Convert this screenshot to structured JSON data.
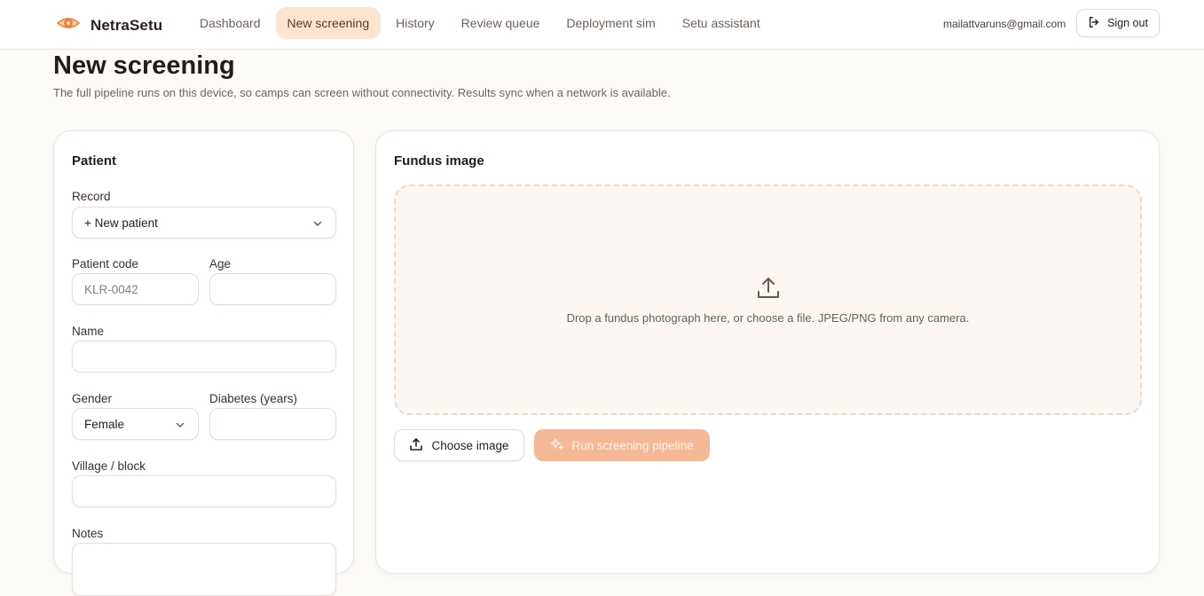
{
  "brand": {
    "name": "NetraSetu",
    "accent": "#f0803c"
  },
  "nav": [
    {
      "label": "Dashboard",
      "active": false
    },
    {
      "label": "New screening",
      "active": true
    },
    {
      "label": "History",
      "active": false
    },
    {
      "label": "Review queue",
      "active": false
    },
    {
      "label": "Deployment sim",
      "active": false
    },
    {
      "label": "Setu assistant",
      "active": false
    }
  ],
  "user": {
    "email": "mailattvaruns@gmail.com",
    "signout_label": "Sign out",
    "signout_icon": "logout-icon"
  },
  "page": {
    "title": "New screening",
    "subtitle": "The full pipeline runs on this device, so camps can screen without connectivity. Results sync when a network is available."
  },
  "patient": {
    "title": "Patient",
    "record_label": "Record",
    "record_value": "+ New patient",
    "code_label": "Patient code",
    "code_placeholder": "KLR-0042",
    "age_label": "Age",
    "name_label": "Name",
    "gender_label": "Gender",
    "gender_value": "Female",
    "diabetes_label": "Diabetes (years)",
    "village_label": "Village / block",
    "notes_label": "Notes"
  },
  "fundus": {
    "title": "Fundus image",
    "drop_text": "Drop a fundus photograph here, or choose a file. JPEG/PNG from any camera.",
    "upload_icon": "upload-icon",
    "choose_label": "Choose image",
    "run_label": "Run screening pipeline",
    "run_icon": "sparkles-icon"
  }
}
